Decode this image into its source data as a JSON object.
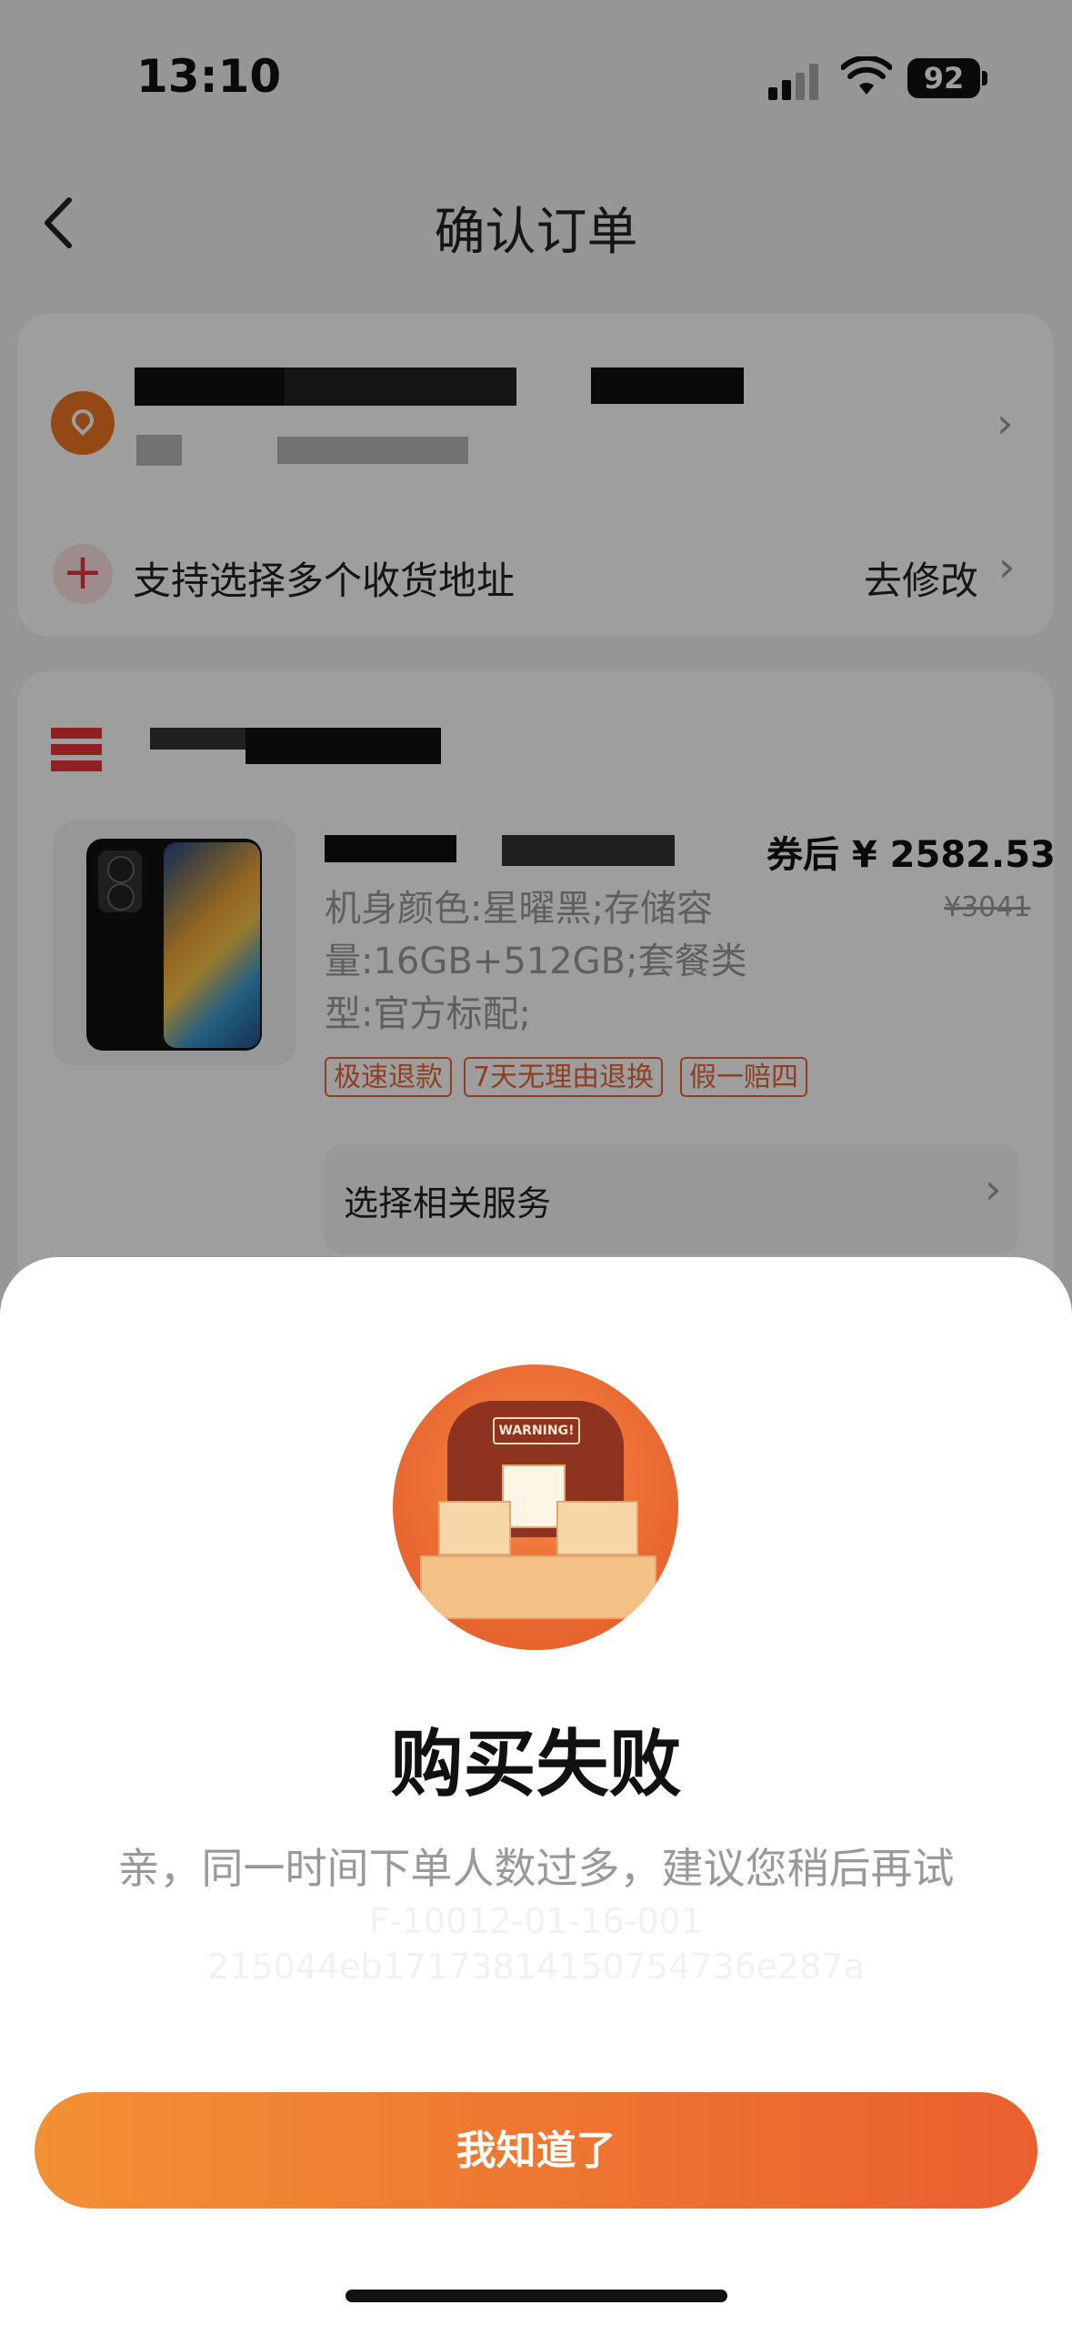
{
  "status_bar": {
    "time": "13:10",
    "battery": "92"
  },
  "header": {
    "title": "确认订单"
  },
  "address": {
    "multi_address_label": "支持选择多个收货地址",
    "modify_label": "去修改"
  },
  "product": {
    "price_after_coupon": "券后 ¥ 2582.53",
    "original_price": "¥3041",
    "spec": "机身颜色:星曜黑;存储容量:16GB+512GB;套餐类型:官方标配;",
    "tags": [
      "极速退款",
      "7天无理由退换",
      "假一赔四"
    ],
    "service_label": "选择相关服务"
  },
  "dialog": {
    "illustration_badge": "WARNING!",
    "title": "购买失败",
    "message": "亲，同一时间下单人数过多，建议您稍后再试",
    "error_code": "F-10012-01-16-001",
    "trace_id": "215044eb17173814150754736e287a",
    "confirm_label": "我知道了"
  },
  "colors": {
    "accent_orange": "#ea5f2f",
    "accent_red": "#e9343b"
  }
}
